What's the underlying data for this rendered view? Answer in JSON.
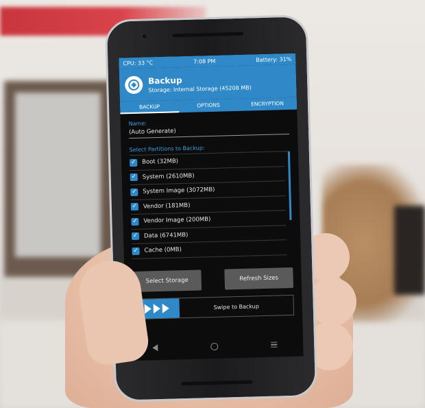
{
  "status_bar": {
    "cpu": "CPU: 33 °C",
    "time": "7:08 PM",
    "battery": "Battery: 31%"
  },
  "header": {
    "title": "Backup",
    "storage": "Storage: Internal Storage (45208 MB)",
    "icon": "twrp-logo-icon"
  },
  "tabs": [
    {
      "label": "BACKUP",
      "active": true
    },
    {
      "label": "OPTIONS",
      "active": false
    },
    {
      "label": "ENCRYPTION",
      "active": false
    }
  ],
  "name_field": {
    "label": "Name:",
    "value": "(Auto Generate)"
  },
  "partitions": {
    "label": "Select Partitions to Backup:",
    "items": [
      {
        "label": "Boot (32MB)",
        "checked": true
      },
      {
        "label": "System (2610MB)",
        "checked": true
      },
      {
        "label": "System Image (3072MB)",
        "checked": true
      },
      {
        "label": "Vendor (181MB)",
        "checked": true
      },
      {
        "label": "Vendor Image (200MB)",
        "checked": true
      },
      {
        "label": "Data (6741MB)",
        "checked": true
      },
      {
        "label": "Cache (0MB)",
        "checked": true
      }
    ]
  },
  "buttons": {
    "select_storage": "Select Storage",
    "refresh_sizes": "Refresh Sizes"
  },
  "swipe": {
    "label": "Swipe to Backup"
  },
  "colors": {
    "accent": "#2f89c9",
    "screen_bg": "#0c0c0c",
    "button_bg": "#5a5a5a"
  }
}
